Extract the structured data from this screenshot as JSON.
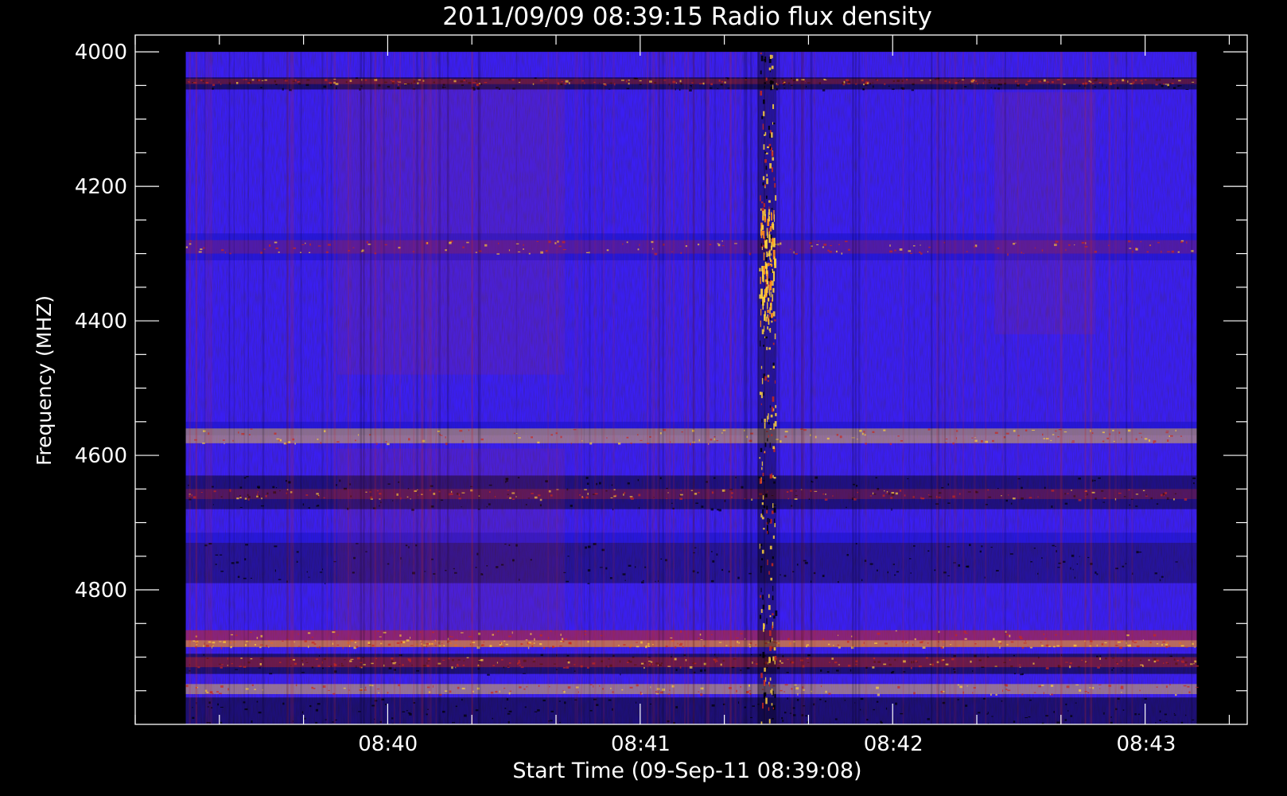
{
  "chart_data": {
    "type": "heatmap",
    "title": "2011/09/09 08:39:15 Radio flux density",
    "xlabel": "Start Time (09-Sep-11 08:39:08)",
    "ylabel": "Frequency (MHZ)",
    "x_ticks": [
      "08:40",
      "08:41",
      "08:42",
      "08:43"
    ],
    "x_tick_minutes": [
      1,
      2,
      3,
      4
    ],
    "x_minor_step_minutes": 0.333,
    "xlim_minutes": [
      0.0,
      4.4
    ],
    "data_x_range_minutes": [
      0.2,
      4.2
    ],
    "y_ticks": [
      "4000",
      "4200",
      "4400",
      "4600",
      "4800"
    ],
    "y_tick_values": [
      4000,
      4200,
      4400,
      4600,
      4800
    ],
    "y_minor_step": 50,
    "ylim": [
      3975,
      5000
    ],
    "y_inverted": true,
    "data_y_range": [
      4000,
      5000
    ],
    "colors": {
      "background": "#000000",
      "base": "#3a1ef2",
      "axes": "#ffffff",
      "red": "#c8281e",
      "yellow": "#ffd23c",
      "dark": "#000000"
    },
    "bands": [
      {
        "y0": 4038,
        "y1": 4056,
        "type": "dark",
        "strength": 0.55
      },
      {
        "y0": 4040,
        "y1": 4048,
        "type": "red",
        "strength": 0.35
      },
      {
        "y0": 4270,
        "y1": 4310,
        "type": "blue",
        "strength": 0.6
      },
      {
        "y0": 4280,
        "y1": 4300,
        "type": "red",
        "strength": 0.25
      },
      {
        "y0": 4550,
        "y1": 4570,
        "type": "blue",
        "strength": 0.6
      },
      {
        "y0": 4560,
        "y1": 4582,
        "type": "yellow",
        "strength": 0.45
      },
      {
        "y0": 4630,
        "y1": 4680,
        "type": "dark",
        "strength": 0.45
      },
      {
        "y0": 4650,
        "y1": 4665,
        "type": "red",
        "strength": 0.3
      },
      {
        "y0": 4715,
        "y1": 4730,
        "type": "blue",
        "strength": 0.55
      },
      {
        "y0": 4730,
        "y1": 4790,
        "type": "dark",
        "strength": 0.35
      },
      {
        "y0": 4860,
        "y1": 4885,
        "type": "red",
        "strength": 0.55
      },
      {
        "y0": 4875,
        "y1": 4885,
        "type": "yellow",
        "strength": 0.4
      },
      {
        "y0": 4895,
        "y1": 4925,
        "type": "dark",
        "strength": 0.5
      },
      {
        "y0": 4900,
        "y1": 4915,
        "type": "red",
        "strength": 0.45
      },
      {
        "y0": 4940,
        "y1": 4955,
        "type": "yellow",
        "strength": 0.45
      },
      {
        "y0": 4960,
        "y1": 5000,
        "type": "dark",
        "strength": 0.5
      }
    ],
    "burst": {
      "x_minutes": 2.5,
      "y_range": [
        4000,
        5000
      ],
      "peak_y_range": [
        4230,
        4400
      ]
    }
  }
}
